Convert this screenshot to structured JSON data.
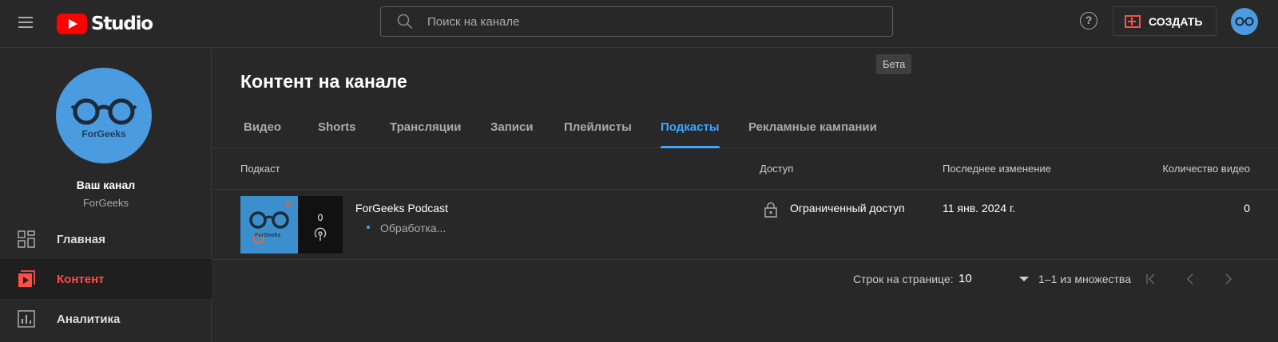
{
  "header": {
    "logo_text": "Studio",
    "search_placeholder": "Поиск на канале",
    "help_label": "?",
    "create_label": "СОЗДАТЬ"
  },
  "sidebar": {
    "avatar_text": "ForGeeks",
    "your_channel": "Ваш канал",
    "channel_handle": "ForGeeks",
    "items": [
      {
        "label": "Главная",
        "icon": "dashboard-icon"
      },
      {
        "label": "Контент",
        "icon": "content-icon",
        "active": true
      },
      {
        "label": "Аналитика",
        "icon": "analytics-icon"
      }
    ]
  },
  "main": {
    "title": "Контент на канале",
    "tabs": [
      {
        "label": "Видео"
      },
      {
        "label": "Shorts"
      },
      {
        "label": "Трансляции"
      },
      {
        "label": "Записи"
      },
      {
        "label": "Плейлисты"
      },
      {
        "label": "Подкасты",
        "active": true
      },
      {
        "label": "Рекламные кампании"
      }
    ],
    "beta_badge": "Бета",
    "columns": {
      "podcast": "Подкаст",
      "access": "Доступ",
      "modified": "Последнее изменение",
      "count": "Количество видео"
    },
    "rows": [
      {
        "title": "ForGeeks Podcast",
        "status": "Обработка...",
        "thumb_count": "0",
        "thumb_text": "ForGeeks",
        "access": "Ограниченный доступ",
        "modified": "11 янв. 2024 г.",
        "video_count": "0"
      }
    ],
    "pagination": {
      "rows_label": "Строк на странице:",
      "rows_value": "10",
      "range": "1–1 из множества"
    }
  },
  "colors": {
    "accent": "#3ea6ff",
    "active_nav": "#ff4e45",
    "background": "#282828",
    "avatar": "#4a9be0"
  }
}
